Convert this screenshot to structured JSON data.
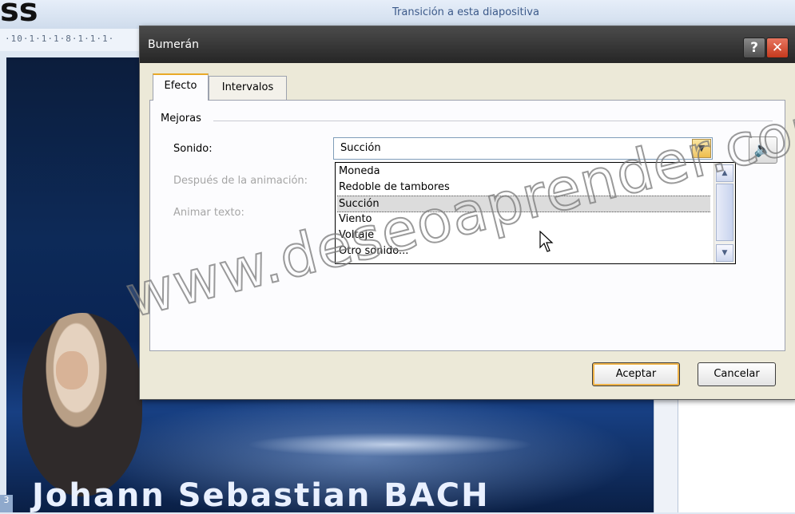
{
  "app": {
    "top_glyph": "ss",
    "transition_link": "Transición a esta diapositiva",
    "ruler_text": "·10·1·1·1·8·1·1·1·",
    "slide_title": "Johann Sebastian BACH",
    "side_tag": "3"
  },
  "dialog": {
    "title": "Bumerán",
    "help_label": "?",
    "close_label": "✕",
    "tabs": [
      {
        "label": "Efecto",
        "active": true
      },
      {
        "label": "Intervalos",
        "active": false
      }
    ],
    "group_label": "Mejoras",
    "fields": {
      "sonido_label": "Sonido:",
      "despues_label": "Después de la animación:",
      "animar_label": "Animar texto:"
    },
    "sound_combo": {
      "value": "Succión",
      "arrow": "▼"
    },
    "sound_options": [
      {
        "label": "Moneda",
        "selected": false
      },
      {
        "label": "Redoble de tambores",
        "selected": false
      },
      {
        "label": "Succión",
        "selected": true
      },
      {
        "label": "Viento",
        "selected": false
      },
      {
        "label": "Voltaje",
        "selected": false
      },
      {
        "label": "Otro sonido...",
        "selected": false
      }
    ],
    "speaker_icon": "🔈",
    "ok_label": "Aceptar",
    "cancel_label": "Cancelar"
  },
  "watermark": "www.deseoaprender.com",
  "colors": {
    "titlebar": "#333333",
    "close_button": "#c4391d",
    "dialog_bg": "#ece9d8",
    "ok_focus_ring": "#f0b44a",
    "slide_bg": "#0d2a58"
  }
}
